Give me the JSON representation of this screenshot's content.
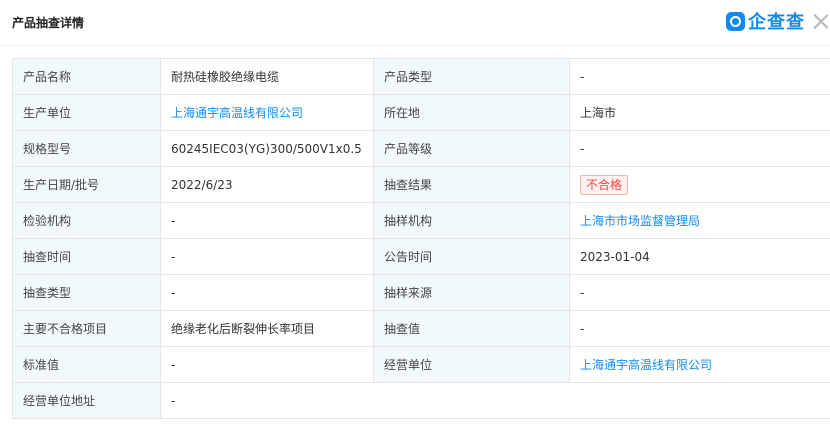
{
  "header": {
    "title": "产品抽查详情",
    "brand_name": "企查查",
    "brand_icon": "qichacha-logo-icon",
    "close_icon": "close-icon"
  },
  "colors": {
    "link": "#128bed",
    "label_bg": "#f2f9fc",
    "fail_badge": "#e94a4a"
  },
  "details": {
    "product_name_label": "产品名称",
    "product_name": "耐热硅橡胶绝缘电缆",
    "product_type_label": "产品类型",
    "product_type": "-",
    "producer_label": "生产单位",
    "producer": "上海通宇高温线有限公司",
    "location_label": "所在地",
    "location": "上海市",
    "spec_label": "规格型号",
    "spec": "60245IEC03(YG)300/500V1x0.5",
    "grade_label": "产品等级",
    "grade": "-",
    "batch_label": "生产日期/批号",
    "batch": "2022/6/23",
    "result_label": "抽查结果",
    "result": "不合格",
    "inspection_org_label": "检验机构",
    "inspection_org": "-",
    "sampling_org_label": "抽样机构",
    "sampling_org": "上海市市场监督管理局",
    "check_time_label": "抽查时间",
    "check_time": "-",
    "announce_time_label": "公告时间",
    "announce_time": "2023-01-04",
    "check_type_label": "抽查类型",
    "check_type": "-",
    "sample_source_label": "抽样来源",
    "sample_source": "-",
    "failed_items_label": "主要不合格项目",
    "failed_items": "绝缘老化后断裂伸长率项目",
    "check_value_label": "抽查值",
    "check_value": "-",
    "standard_label": "标准值",
    "standard": "-",
    "operator_label": "经营单位",
    "operator": "上海通宇高温线有限公司",
    "operator_address_label": "经营单位地址",
    "operator_address": "-"
  }
}
